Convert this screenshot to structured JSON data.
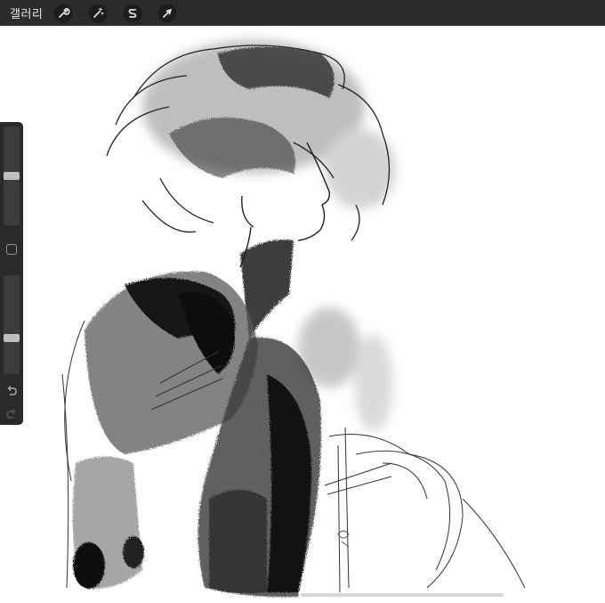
{
  "toolbar": {
    "gallery_label": "갤러리",
    "tools": [
      {
        "icon": "wrench-icon",
        "name": "actions"
      },
      {
        "icon": "magic-wand-icon",
        "name": "adjustments"
      },
      {
        "icon": "selection-s-icon",
        "name": "selection"
      },
      {
        "icon": "arrow-cursor-icon",
        "name": "transform"
      }
    ]
  },
  "sidebar": {
    "brush_size_level": 0.5,
    "opacity_level": 0.35,
    "icons": [
      "square-modify-icon",
      "undo-icon",
      "redo-icon"
    ]
  },
  "colors": {
    "toolbar_bg": "#2b2b2b",
    "sidebar_bg": "#2a2a2a",
    "canvas_bg": "#ffffff"
  }
}
